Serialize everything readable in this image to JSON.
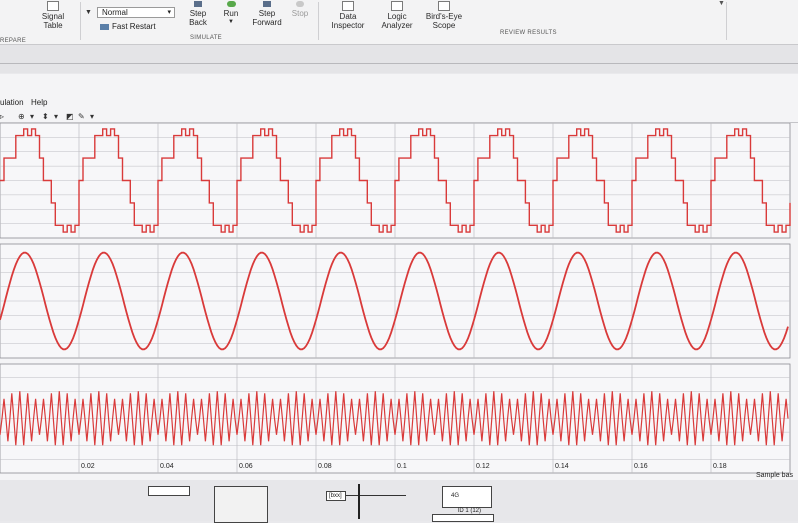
{
  "ribbon": {
    "signal_table_label": "Signal\nTable",
    "mode_value": "Normal",
    "fast_restart_label": "Fast Restart",
    "step_back_label": "Step\nBack",
    "run_label": "Run",
    "step_forward_label": "Step\nForward",
    "stop_label": "Stop",
    "data_inspector_label": "Data\nInspector",
    "logic_analyzer_label": "Logic\nAnalyzer",
    "birds_eye_label": "Bird's-Eye\nScope",
    "group_prepare": "REPARE",
    "group_simulate": "SIMULATE",
    "group_review": "REVIEW RESULTS"
  },
  "scope": {
    "menu": [
      "ulation",
      "Help"
    ],
    "x_ticks": [
      "0.02",
      "0.04",
      "0.06",
      "0.08",
      "0.1",
      "0.12",
      "0.14",
      "0.16",
      "0.18"
    ],
    "sample_label": "Sample bas"
  },
  "model": {
    "from_block_label": "[bxx]",
    "block2_label": "4G",
    "block2_sub": "lD 1 (12)"
  },
  "colors": {
    "trace": "#d93a3a",
    "grid": "#bdbdc2",
    "plot_bg": "#f7f7f9"
  },
  "chart_data": [
    {
      "type": "line",
      "title": "",
      "xlabel": "",
      "ylabel": "",
      "description_shape": "multilevel stepped waveform",
      "period": 0.02,
      "x": [
        0,
        0.001,
        0.003,
        0.004,
        0.005,
        0.006,
        0.007,
        0.008,
        0.009,
        0.01,
        0.011,
        0.013,
        0.014,
        0.015,
        0.016,
        0.017,
        0.018,
        0.019,
        0.02
      ],
      "y": [
        0,
        0.5,
        0.5,
        1,
        1,
        1.15,
        1,
        1.15,
        1,
        0.5,
        0,
        -0.5,
        -1,
        -1,
        -1.15,
        -1,
        -1.15,
        -1,
        -0.5
      ]
    },
    {
      "type": "line",
      "title": "",
      "xlabel": "",
      "ylabel": "",
      "description_shape": "sinusoid",
      "period": 0.02,
      "amplitude": 1
    },
    {
      "type": "line",
      "title": "",
      "xlabel": "",
      "ylabel": "",
      "description_shape": "high-frequency sawtooth/triangle",
      "period": 0.002,
      "amplitude": 1
    }
  ]
}
